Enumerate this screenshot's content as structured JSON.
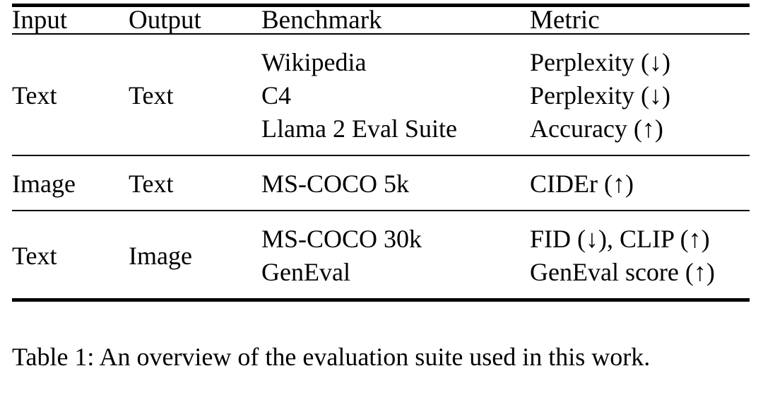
{
  "table": {
    "id": "table-1",
    "columns": [
      "Input",
      "Output",
      "Benchmark",
      "Metric"
    ],
    "rows": [
      {
        "input": "Text",
        "output": "Text",
        "benchmarks": [
          "Wikipedia",
          "C4",
          "Llama 2 Eval Suite"
        ],
        "metrics": [
          "Perplexity (↓)",
          "Perplexity (↓)",
          "Accuracy (↑)"
        ]
      },
      {
        "input": "Image",
        "output": "Text",
        "benchmarks": [
          "MS-COCO 5k"
        ],
        "metrics": [
          "CIDEr (↑)"
        ]
      },
      {
        "input": "Text",
        "output": "Image",
        "benchmarks": [
          "MS-COCO 30k",
          "GenEval"
        ],
        "metrics": [
          "FID (↓), CLIP (↑)",
          "GenEval score (↑)"
        ]
      }
    ]
  },
  "caption": {
    "label": "Table 1:",
    "text": "An overview of the evaluation suite used in this work.",
    "full": "Table 1: An overview of the evaluation suite used in this work."
  },
  "colors": {
    "text": "#000000",
    "background": "#ffffff",
    "rule": "#000000"
  }
}
